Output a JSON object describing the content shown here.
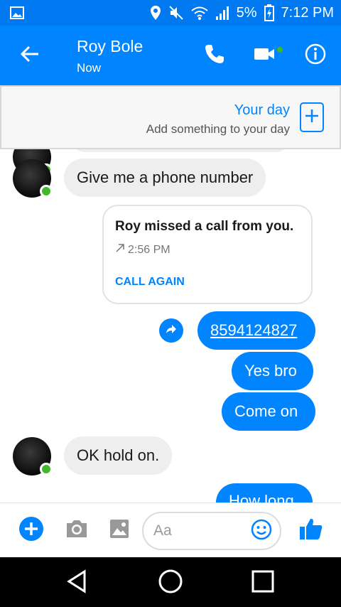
{
  "status_bar": {
    "battery": "5%",
    "time": "7:12 PM",
    "icons": [
      "gallery-icon",
      "location-icon",
      "mute-icon",
      "wifi-icon",
      "signal-icon",
      "battery-charging-icon"
    ]
  },
  "header": {
    "name": "Roy Bole",
    "status": "Now",
    "actions": [
      "back-arrow-icon",
      "phone-icon",
      "video-icon",
      "info-icon"
    ]
  },
  "your_day": {
    "title": "Your day",
    "subtitle": "Add something to your day"
  },
  "messages": {
    "incoming_1": "Give me a phone number",
    "call_card": {
      "title": "Roy missed a call from you.",
      "time": "2:56 PM",
      "action": "CALL AGAIN"
    },
    "outgoing_phone": "8594124827",
    "outgoing_1": "Yes bro",
    "outgoing_2": "Come on",
    "incoming_2": "OK hold on.",
    "outgoing_partial": "How long"
  },
  "composer": {
    "placeholder": "Aa",
    "icons": [
      "plus-icon",
      "camera-icon",
      "image-icon",
      "emoji-icon",
      "thumbs-up-icon"
    ]
  },
  "navbar": {
    "icons": [
      "back-triangle-icon",
      "home-circle-icon",
      "recents-square-icon"
    ]
  },
  "colors": {
    "status_bar": "#0078f0",
    "header": "#0084ff",
    "accent": "#0084ff",
    "bubble_in": "#eeeeee",
    "online": "#42b72a"
  }
}
